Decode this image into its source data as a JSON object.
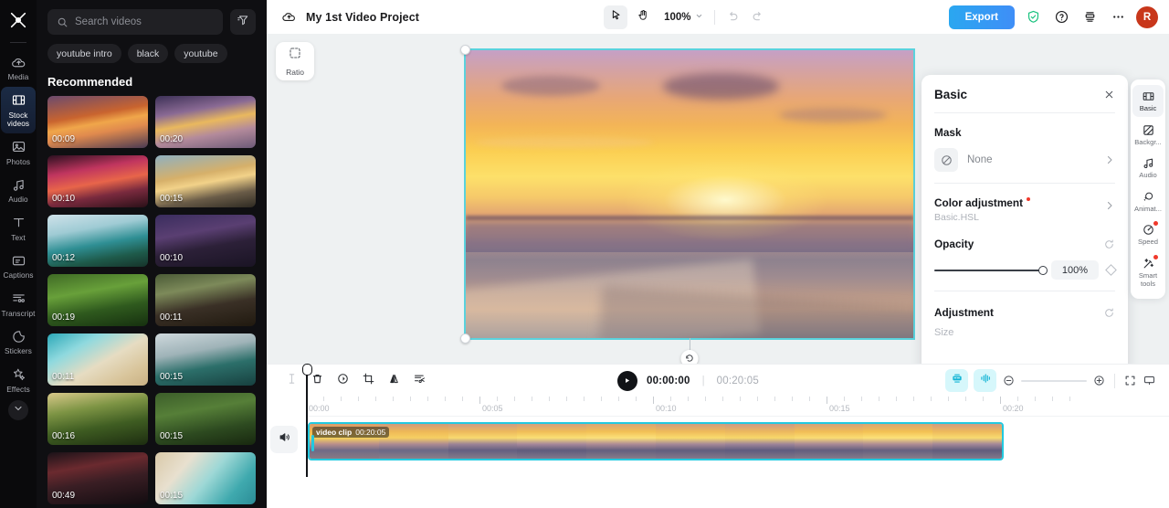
{
  "rail": {
    "logo_icon": "capcut-logo-icon",
    "items": [
      {
        "label": "Media",
        "icon": "cloud-upload-icon",
        "active": false
      },
      {
        "label": "Stock videos",
        "icon": "film-strip-icon",
        "active": true
      },
      {
        "label": "Photos",
        "icon": "photo-icon",
        "active": false
      },
      {
        "label": "Audio",
        "icon": "music-note-icon",
        "active": false
      },
      {
        "label": "Text",
        "icon": "text-t-icon",
        "active": false
      },
      {
        "label": "Captions",
        "icon": "captions-icon",
        "active": false
      },
      {
        "label": "Transcript",
        "icon": "transcript-icon",
        "active": false
      },
      {
        "label": "Stickers",
        "icon": "sticker-icon",
        "active": false
      },
      {
        "label": "Effects",
        "icon": "sparkle-star-icon",
        "active": false
      }
    ],
    "expand_icon": "chevron-down-icon"
  },
  "library": {
    "search": {
      "placeholder": "Search videos",
      "value": "",
      "icon": "search-icon"
    },
    "filter_icon": "filter-icon",
    "chips": [
      "youtube intro",
      "black",
      "youtube"
    ],
    "heading": "Recommended",
    "thumbnails": [
      {
        "duration": "00:09",
        "scene": "ocean-sunset-orange"
      },
      {
        "duration": "00:20",
        "scene": "beach-sunset-purple"
      },
      {
        "duration": "00:10",
        "scene": "pink-sunset-lake"
      },
      {
        "duration": "00:15",
        "scene": "golden-lake-sunset"
      },
      {
        "duration": "00:12",
        "scene": "turquoise-coast-cliff"
      },
      {
        "duration": "00:10",
        "scene": "night-city-lights"
      },
      {
        "duration": "00:19",
        "scene": "green-forest-trees"
      },
      {
        "duration": "00:11",
        "scene": "panda-on-bench"
      },
      {
        "duration": "00:11",
        "scene": "aerial-beach-waves"
      },
      {
        "duration": "00:15",
        "scene": "wind-turbines-sea"
      },
      {
        "duration": "00:16",
        "scene": "sunlit-jungle"
      },
      {
        "duration": "00:15",
        "scene": "aerial-green-river"
      },
      {
        "duration": "00:49",
        "scene": "night-street-neon"
      },
      {
        "duration": "00:15",
        "scene": "aerial-turquoise-shore"
      }
    ],
    "collapse_icon": "chevron-left-icon"
  },
  "topbar": {
    "cloud_icon": "cloud-sync-icon",
    "project_title": "My 1st Video Project",
    "select_tool_icon": "cursor-arrow-icon",
    "hand_tool_icon": "hand-icon",
    "zoom_level": "100%",
    "zoom_chevron_icon": "chevron-down-icon",
    "undo_icon": "undo-icon",
    "redo_icon": "redo-icon",
    "export_label": "Export",
    "shield_icon": "shield-check-icon",
    "help_icon": "question-circle-icon",
    "layers_icon": "stack-icon",
    "more_icon": "more-horizontal-icon",
    "avatar_initial": "R"
  },
  "stage": {
    "ratio_label": "Ratio",
    "ratio_icon": "crop-frame-icon",
    "rotate_icon": "rotate-icon",
    "selection_color": "#5ad2dd"
  },
  "properties": {
    "title": "Basic",
    "close_icon": "close-icon",
    "mask": {
      "label": "Mask",
      "value": "None",
      "icon": "no-mask-icon",
      "chevron_icon": "chevron-right-icon"
    },
    "color_adjustment": {
      "label": "Color adjustment",
      "sub": "Basic.HSL",
      "badge": true,
      "chevron_icon": "chevron-right-icon"
    },
    "opacity": {
      "label": "Opacity",
      "value": "100%",
      "percent": 100,
      "reset_icon": "reset-icon",
      "keyframe_icon": "keyframe-diamond-icon"
    },
    "adjustment": {
      "label": "Adjustment",
      "size_label": "Size",
      "reset_icon": "reset-icon"
    },
    "accent_red": "#f0392b"
  },
  "prop_rail": {
    "items": [
      {
        "label": "Basic",
        "icon": "film-strip-icon",
        "active": true,
        "badge": false
      },
      {
        "label": "Backgr...",
        "icon": "background-icon",
        "active": false,
        "badge": false
      },
      {
        "label": "Audio",
        "icon": "music-note-icon",
        "active": false,
        "badge": false
      },
      {
        "label": "Animat...",
        "icon": "animation-icon",
        "active": false,
        "badge": false
      },
      {
        "label": "Speed",
        "icon": "speedometer-icon",
        "active": false,
        "badge": true
      },
      {
        "label": "Smart tools",
        "icon": "magic-wand-icon",
        "active": false,
        "badge": true
      }
    ]
  },
  "timeline": {
    "tools": [
      {
        "name": "split",
        "icon": "split-icon",
        "dim": true
      },
      {
        "name": "delete",
        "icon": "trash-icon",
        "dim": false
      },
      {
        "name": "rotate",
        "icon": "rotate-clockwise-icon",
        "dim": false
      },
      {
        "name": "crop",
        "icon": "crop-icon",
        "dim": false
      },
      {
        "name": "mirror",
        "icon": "mirror-flip-icon",
        "dim": false
      },
      {
        "name": "auto-cut",
        "icon": "auto-cut-icon",
        "dim": false
      }
    ],
    "play_icon": "play-icon",
    "current_time": "00:00:00",
    "separator": "|",
    "total_time": "00:20:05",
    "auto_captions_icon": "auto-captions-icon",
    "audio_wave_icon": "audio-wave-icon",
    "zoom_out_icon": "zoom-out-circle-icon",
    "zoom_in_icon": "zoom-in-circle-icon",
    "fullscreen_icon": "fullscreen-icon",
    "present_icon": "present-screen-icon",
    "ruler_labels": [
      "00:00",
      "00:05",
      "00:10",
      "00:15",
      "00:20"
    ],
    "mute_icon": "speaker-icon",
    "clip": {
      "name": "video clip",
      "duration": "00:20:05"
    }
  }
}
